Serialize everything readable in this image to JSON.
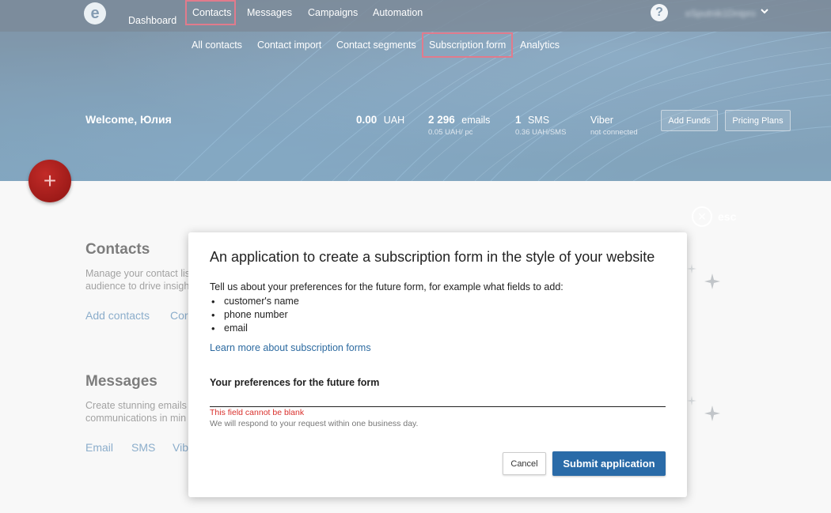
{
  "topnav": {
    "dashboard": "Dashboard",
    "contacts": "Contacts",
    "messages": "Messages",
    "campaigns": "Campaigns",
    "automation": "Automation",
    "help": "?",
    "user": "eSputnik1Dnipro",
    "logo": "e"
  },
  "subnav": {
    "all_contacts": "All contacts",
    "contact_import": "Contact import",
    "contact_segments": "Contact segments",
    "subscription_form": "Subscription form",
    "analytics": "Analytics"
  },
  "header": {
    "welcome": "Welcome, Юлия",
    "balance_value": "0.00",
    "balance_unit": "UAH",
    "emails_value": "2 296",
    "emails_unit": "emails",
    "emails_price": "0.05 UAH/ pc",
    "sms_value": "1",
    "sms_unit": "SMS",
    "sms_price": "0.36 UAH/SMS",
    "viber_label": "Viber",
    "viber_status": "not connected",
    "add_funds": "Add Funds",
    "pricing_plans": "Pricing Plans"
  },
  "fab": {
    "label": "+"
  },
  "background": {
    "contacts_title": "Contacts",
    "contacts_desc": "Manage your contact lis audience to drive insigh",
    "contacts_link_add": "Add contacts",
    "contacts_link_other": "Cor",
    "messages_title": "Messages",
    "messages_desc": "Create stunning emails communications in min",
    "messages_link_email": "Email",
    "messages_link_sms": "SMS",
    "messages_link_viber": "Vib"
  },
  "esc": {
    "icon": "✕",
    "label": "esc"
  },
  "modal": {
    "title": "An application to create a subscription form in the style of your website",
    "intro": "Tell us about your preferences for the future form, for example what fields to add:",
    "items": [
      "customer's name",
      "phone number",
      "email"
    ],
    "learn_more": "Learn more about subscription forms",
    "field_label": "Your preferences for the future form",
    "field_value": "",
    "error": "This field cannot be blank",
    "hint": "We will respond to your request within one business day.",
    "cancel": "Cancel",
    "submit": "Submit application"
  },
  "colors": {
    "accent": "#2a6ba8",
    "error": "#d9302c",
    "highlight": "#c8102e",
    "fab": "#b3201d",
    "header": "#1b4f78"
  }
}
